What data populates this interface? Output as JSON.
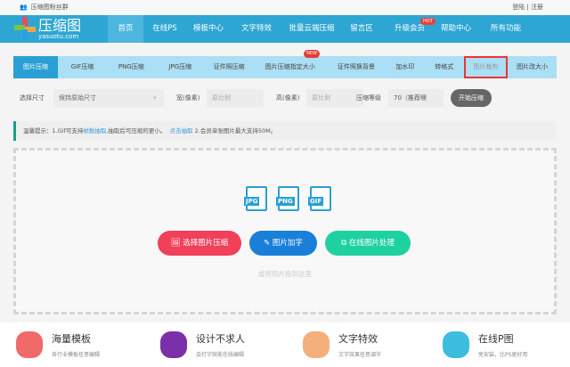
{
  "topbar": {
    "fans": "压缩图粉丝群",
    "auth": "登陆 | 注册"
  },
  "logo": {
    "title": "压缩图",
    "domain": "yasuotu.com"
  },
  "nav": [
    "首页",
    "在线PS",
    "模板中心",
    "文字特效",
    "批量云端压缩",
    "留言区",
    "升级会员",
    "帮助中心",
    "所有功能"
  ],
  "nav_hot": "HOT",
  "tabs": [
    "图片压缩",
    "GIF压缩",
    "PNG压缩",
    "JPG压缩",
    "证件照压缩",
    "图片压缩指定大小",
    "证件照换背景",
    "加水印",
    "转格式",
    "图片裁剪",
    "图片改大小"
  ],
  "tab_new": "NEW",
  "options": {
    "size_label": "选择尺寸",
    "size_value": "保持原始尺寸",
    "width_label": "宽(像素)",
    "width_placeholder": "原比例",
    "height_label": "高(像素)",
    "height_placeholder": "原比例",
    "level_label": "压缩等级",
    "level_value": "70（推荐噢",
    "start": "开始压缩"
  },
  "tip": {
    "prefix": "温馨提示：1.Gif可支持",
    "link1": "帧数抽取",
    "mid": ",抽取后可压缩的更小。",
    "link2": "点击抽取",
    "suffix": " 2.会员单张图片最大支持50M。"
  },
  "formats": [
    "JPG",
    "PNG",
    "GIF"
  ],
  "actions": [
    "选择图片压缩",
    "图片加字",
    "在线图片处理"
  ],
  "drop_hint": "或将照片拖到这里",
  "features": [
    {
      "title": "海量模板",
      "desc": "各行业模板任意编辑",
      "color": "#f06a6a"
    },
    {
      "title": "设计不求人",
      "desc": "会打字就能在线编辑",
      "color": "#7b2fa8"
    },
    {
      "title": "文字特效",
      "desc": "文字效果任意调节",
      "color": "#f4b07a"
    },
    {
      "title": "在线P图",
      "desc": "免安装，比PS更好用",
      "color": "#3bbde0"
    }
  ]
}
